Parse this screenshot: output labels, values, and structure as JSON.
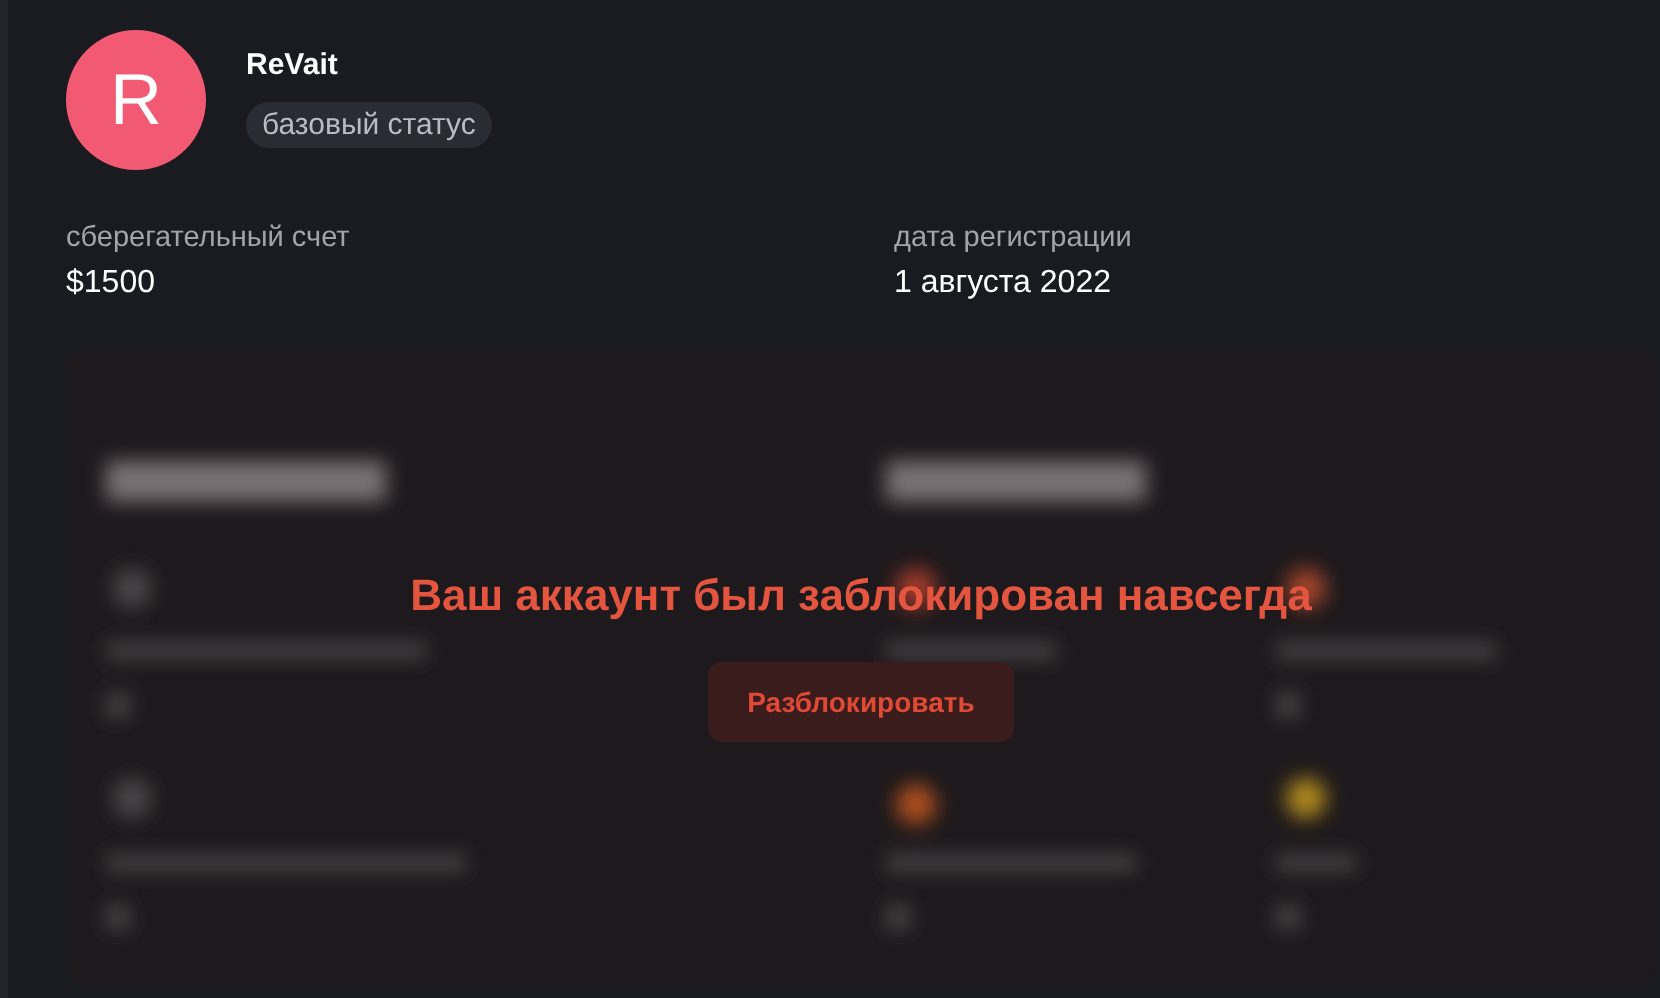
{
  "profile": {
    "avatar_letter": "R",
    "name": "ReVait",
    "status": "базовый статус"
  },
  "stats": [
    {
      "label": "сберегательный счет",
      "value": "$1500"
    },
    {
      "label": "дата регистрации",
      "value": "1 августа 2022"
    }
  ],
  "locked_panel": {
    "message": "Ваш аккаунт был заблокирован навсегда",
    "button": "Разблокировать"
  }
}
